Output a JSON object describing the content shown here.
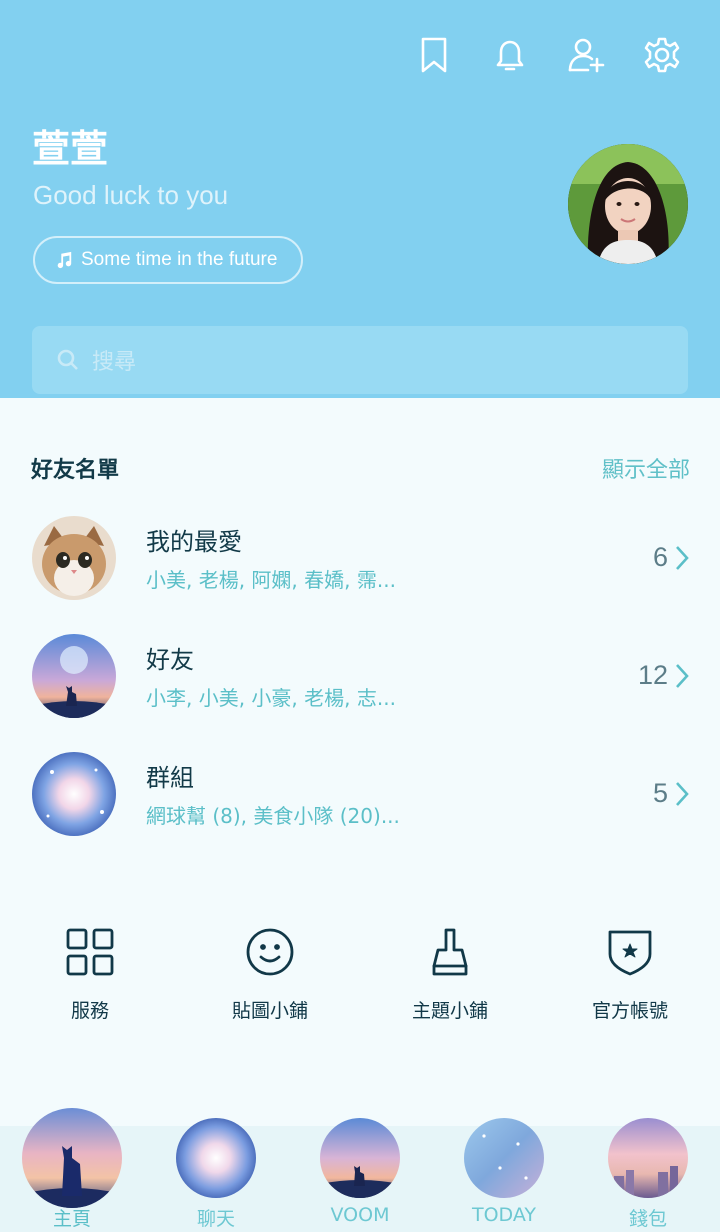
{
  "profile": {
    "name": "萱萱",
    "status": "Good luck to you",
    "music": "Some time in the future"
  },
  "top_icons": [
    "bookmark-icon",
    "bell-icon",
    "add-friend-icon",
    "settings-icon"
  ],
  "search": {
    "placeholder": "搜尋"
  },
  "friends_section": {
    "title": "好友名單",
    "action": "顯示全部",
    "items": [
      {
        "title": "我的最愛",
        "subtitle": "小美, 老楊, 阿嫻, 春嬌, 霈...",
        "count": "6"
      },
      {
        "title": "好友",
        "subtitle": "小李, 小美, 小豪, 老楊, 志...",
        "count": "12"
      },
      {
        "title": "群組",
        "subtitle": "網球幫 (8), 美食小隊 (20)...",
        "count": "5"
      }
    ]
  },
  "quick_actions": [
    {
      "label": "服務",
      "icon": "grid-icon"
    },
    {
      "label": "貼圖小鋪",
      "icon": "smiley-icon"
    },
    {
      "label": "主題小鋪",
      "icon": "brush-icon"
    },
    {
      "label": "官方帳號",
      "icon": "shield-star-icon"
    }
  ],
  "bottom_nav": [
    {
      "label": "主頁"
    },
    {
      "label": "聊天"
    },
    {
      "label": "VOOM"
    },
    {
      "label": "TODAY"
    },
    {
      "label": "錢包"
    }
  ],
  "colors": {
    "header_bg": "#82d0f0",
    "accent": "#5bbfc8",
    "text_dark": "#123a48",
    "body_bg": "#f3fbfd"
  }
}
